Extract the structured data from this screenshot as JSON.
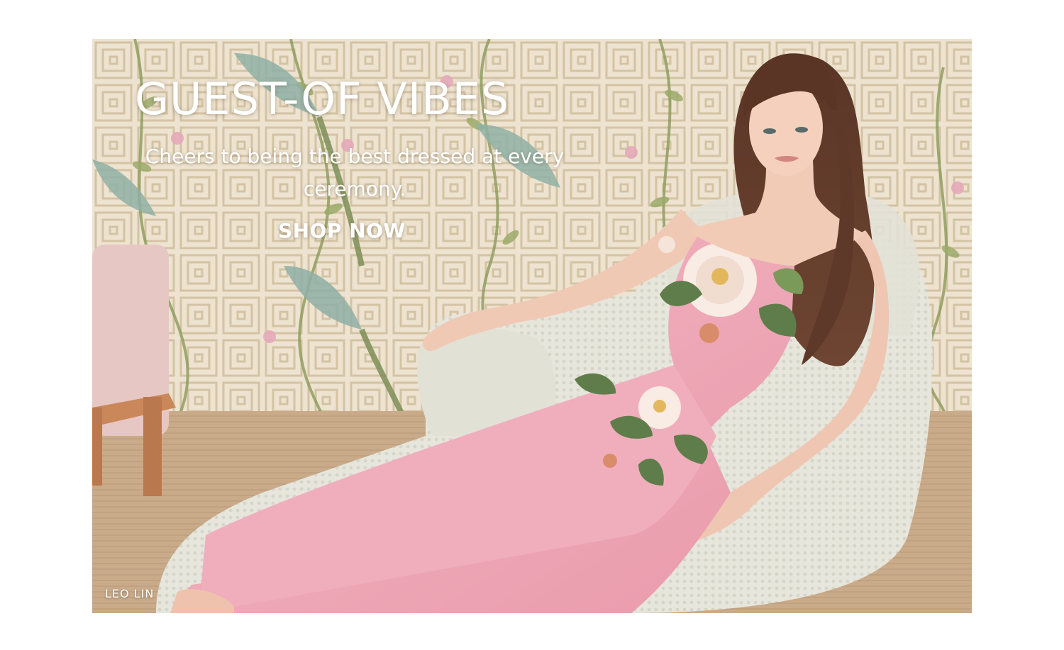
{
  "hero": {
    "headline": "GUEST-OF VIBES",
    "subhead": "Cheers to being the best dressed at every ceremony.",
    "cta_label": "SHOP NOW",
    "photo_credit": "LEO LIN"
  }
}
